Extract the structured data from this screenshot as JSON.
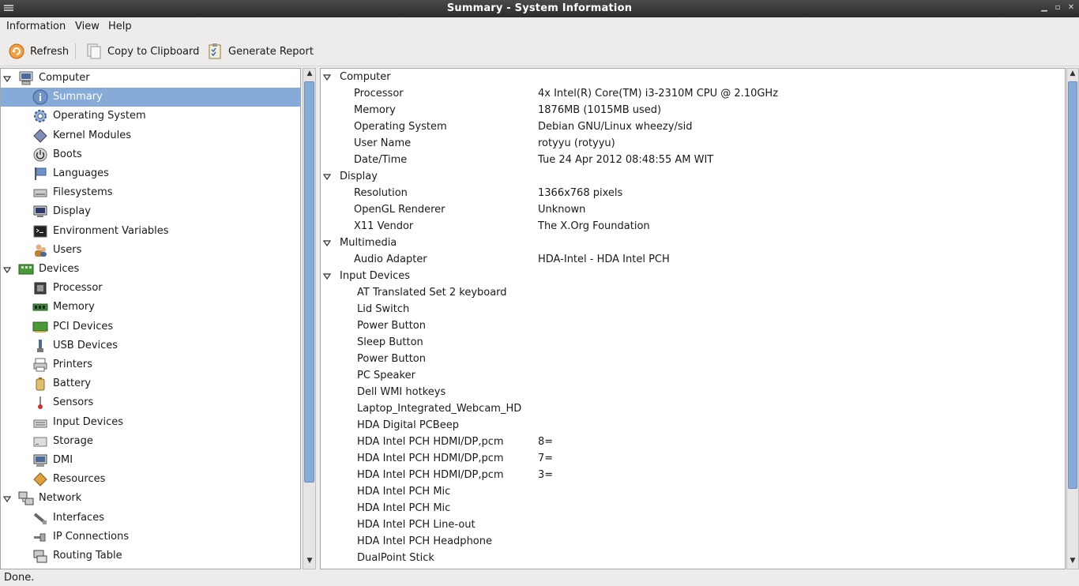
{
  "window": {
    "title": "Summary - System Information"
  },
  "menu": [
    {
      "label": "Information",
      "mnemonic": "I"
    },
    {
      "label": "View",
      "mnemonic": "V"
    },
    {
      "label": "Help",
      "mnemonic": "H"
    }
  ],
  "toolbar": {
    "refresh_label": "Refresh",
    "copy_label": "Copy to Clipboard",
    "report_label": "Generate Report"
  },
  "sidebar": {
    "items": [
      {
        "label": "Computer",
        "icon": "computer-icon",
        "level": 0
      },
      {
        "label": "Summary",
        "icon": "info-icon",
        "level": 1,
        "selected": true
      },
      {
        "label": "Operating System",
        "icon": "gear-icon",
        "level": 1
      },
      {
        "label": "Kernel Modules",
        "icon": "module-icon",
        "level": 1
      },
      {
        "label": "Boots",
        "icon": "power-icon",
        "level": 1
      },
      {
        "label": "Languages",
        "icon": "flag-icon",
        "level": 1
      },
      {
        "label": "Filesystems",
        "icon": "drive-icon",
        "level": 1
      },
      {
        "label": "Display",
        "icon": "monitor-icon",
        "level": 1
      },
      {
        "label": "Environment Variables",
        "icon": "terminal-icon",
        "level": 1
      },
      {
        "label": "Users",
        "icon": "users-icon",
        "level": 1
      },
      {
        "label": "Devices",
        "icon": "board-icon",
        "level": 0
      },
      {
        "label": "Processor",
        "icon": "cpu-icon",
        "level": 1
      },
      {
        "label": "Memory",
        "icon": "memory-icon",
        "level": 1
      },
      {
        "label": "PCI Devices",
        "icon": "pci-icon",
        "level": 1
      },
      {
        "label": "USB Devices",
        "icon": "usb-icon",
        "level": 1
      },
      {
        "label": "Printers",
        "icon": "printer-icon",
        "level": 1
      },
      {
        "label": "Battery",
        "icon": "battery-icon",
        "level": 1
      },
      {
        "label": "Sensors",
        "icon": "thermometer-icon",
        "level": 1
      },
      {
        "label": "Input Devices",
        "icon": "keyboard-icon",
        "level": 1
      },
      {
        "label": "Storage",
        "icon": "storage-icon",
        "level": 1
      },
      {
        "label": "DMI",
        "icon": "dmi-icon",
        "level": 1
      },
      {
        "label": "Resources",
        "icon": "resources-icon",
        "level": 1
      },
      {
        "label": "Network",
        "icon": "network-icon",
        "level": 0
      },
      {
        "label": "Interfaces",
        "icon": "interface-icon",
        "level": 1
      },
      {
        "label": "IP Connections",
        "icon": "plug-icon",
        "level": 1
      },
      {
        "label": "Routing Table",
        "icon": "routing-icon",
        "level": 1
      }
    ]
  },
  "details": {
    "rows": [
      {
        "type": "section",
        "label": "Computer"
      },
      {
        "type": "kv",
        "key": "Processor",
        "value": "4x Intel(R) Core(TM) i3-2310M CPU @ 2.10GHz"
      },
      {
        "type": "kv",
        "key": "Memory",
        "value": "1876MB (1015MB used)"
      },
      {
        "type": "kv",
        "key": "Operating System",
        "value": "Debian GNU/Linux wheezy/sid"
      },
      {
        "type": "kv",
        "key": "User Name",
        "value": "rotyyu (rotyyu)"
      },
      {
        "type": "kv",
        "key": "Date/Time",
        "value": "Tue 24 Apr 2012 08:48:55 AM WIT"
      },
      {
        "type": "section",
        "label": "Display"
      },
      {
        "type": "kv",
        "key": "Resolution",
        "value": "1366x768 pixels"
      },
      {
        "type": "kv",
        "key": "OpenGL Renderer",
        "value": "Unknown"
      },
      {
        "type": "kv",
        "key": "X11 Vendor",
        "value": "The X.Org Foundation"
      },
      {
        "type": "section",
        "label": "Multimedia"
      },
      {
        "type": "kv",
        "key": "Audio Adapter",
        "value": "HDA-Intel - HDA Intel PCH"
      },
      {
        "type": "section",
        "label": "Input Devices"
      },
      {
        "type": "dev",
        "key": "AT Translated Set 2 keyboard",
        "value": ""
      },
      {
        "type": "dev",
        "key": "Lid Switch",
        "value": ""
      },
      {
        "type": "dev",
        "key": "Power Button",
        "value": ""
      },
      {
        "type": "dev",
        "key": "Sleep Button",
        "value": ""
      },
      {
        "type": "dev",
        "key": "Power Button",
        "value": ""
      },
      {
        "type": "dev",
        "key": "PC Speaker",
        "value": ""
      },
      {
        "type": "dev",
        "key": "Dell WMI hotkeys",
        "value": ""
      },
      {
        "type": "dev",
        "key": "Laptop_Integrated_Webcam_HD",
        "value": ""
      },
      {
        "type": "dev",
        "key": "HDA Digital PCBeep",
        "value": ""
      },
      {
        "type": "dev",
        "key": "HDA Intel PCH HDMI/DP,pcm",
        "value": "8="
      },
      {
        "type": "dev",
        "key": "HDA Intel PCH HDMI/DP,pcm",
        "value": "7="
      },
      {
        "type": "dev",
        "key": "HDA Intel PCH HDMI/DP,pcm",
        "value": "3="
      },
      {
        "type": "dev",
        "key": "HDA Intel PCH Mic",
        "value": ""
      },
      {
        "type": "dev",
        "key": "HDA Intel PCH Mic",
        "value": ""
      },
      {
        "type": "dev",
        "key": "HDA Intel PCH Line-out",
        "value": ""
      },
      {
        "type": "dev",
        "key": "HDA Intel PCH Headphone",
        "value": ""
      },
      {
        "type": "dev",
        "key": "DualPoint Stick",
        "value": ""
      }
    ]
  },
  "status": {
    "text": "Done."
  },
  "colors": {
    "selection": "#86abd9",
    "titlebar": "#2b2b2b"
  }
}
